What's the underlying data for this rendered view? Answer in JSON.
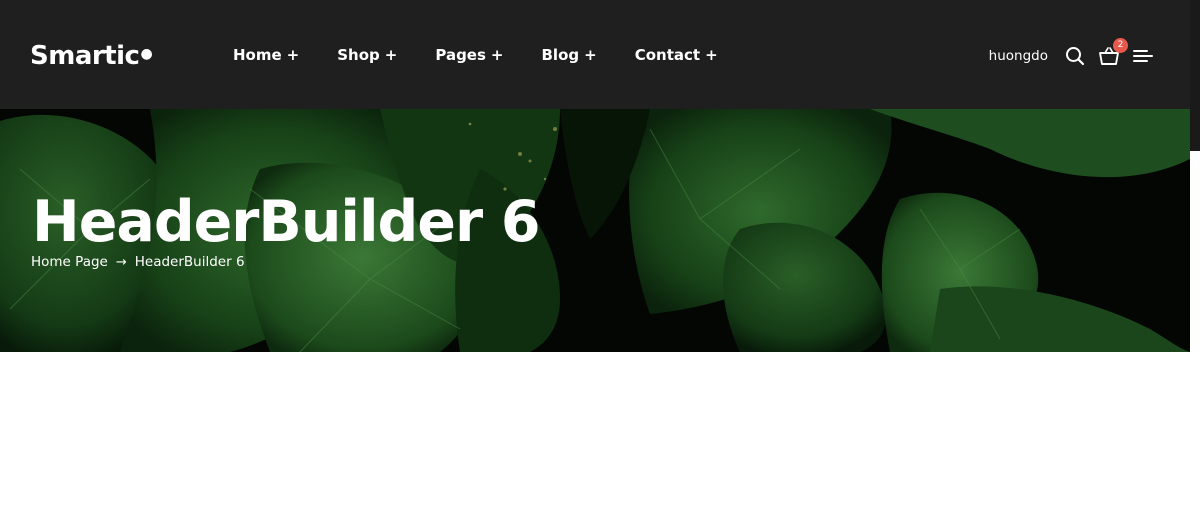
{
  "header": {
    "logo": "Smartic",
    "nav": [
      {
        "label": "Home",
        "suffix": "+"
      },
      {
        "label": "Shop",
        "suffix": "+"
      },
      {
        "label": "Pages",
        "suffix": "+"
      },
      {
        "label": "Blog",
        "suffix": "+"
      },
      {
        "label": "Contact",
        "suffix": "+"
      }
    ],
    "username": "huongdo",
    "cart_count": "2",
    "icons": {
      "search": "search-icon",
      "cart": "cart-icon",
      "menu": "menu-icon"
    }
  },
  "hero": {
    "title": "HeaderBuilder 6",
    "breadcrumb": {
      "home": "Home Page",
      "separator": "→",
      "current": "HeaderBuilder 6"
    }
  },
  "colors": {
    "header_bg": "#1f1f1f",
    "badge": "#e8584b",
    "leaf_dark": "#0b2a0d",
    "leaf_mid": "#1c4a1e"
  }
}
